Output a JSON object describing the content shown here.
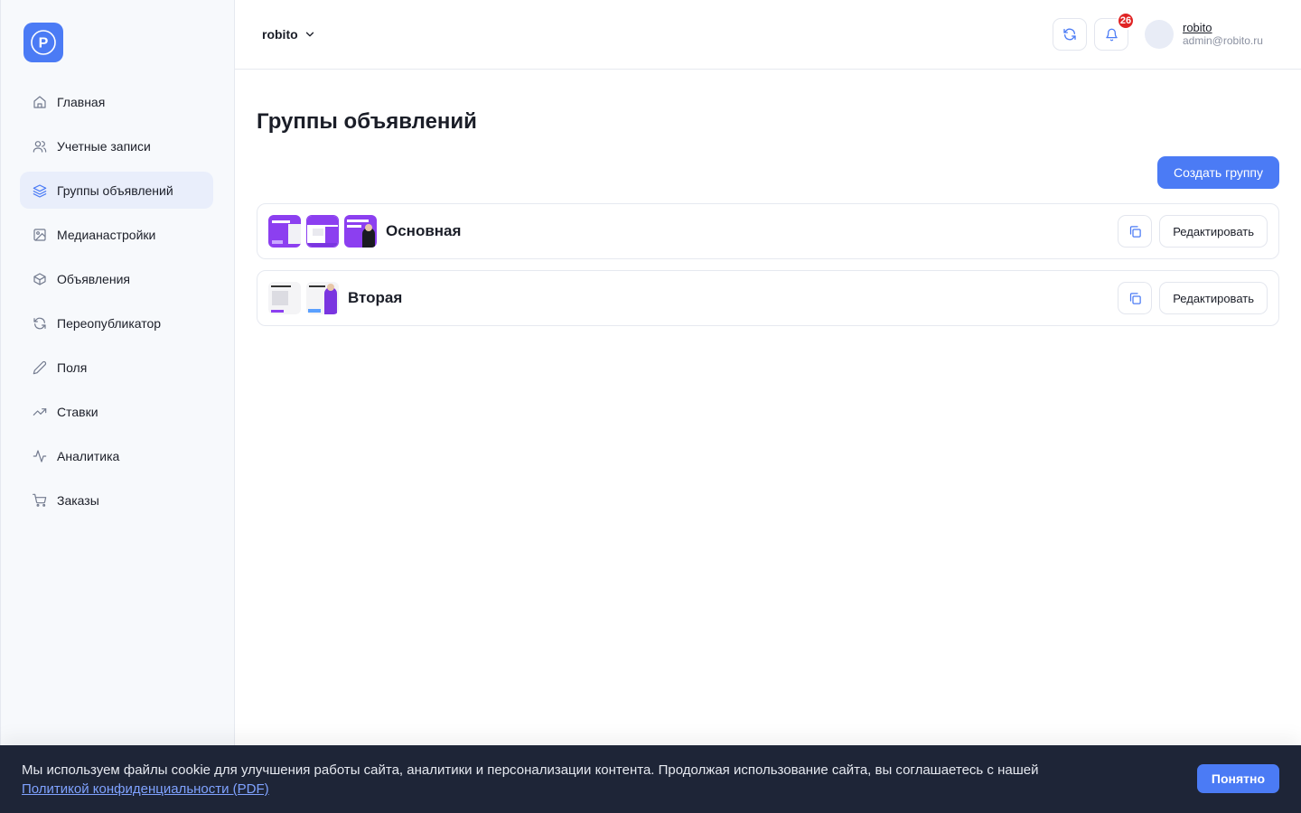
{
  "app": {
    "logo_letter": "P",
    "accent": "#4b7bf5"
  },
  "sidebar": {
    "items": [
      {
        "label": "Главная",
        "icon": "home-icon",
        "active": false
      },
      {
        "label": "Учетные записи",
        "icon": "users-icon",
        "active": false
      },
      {
        "label": "Группы объявлений",
        "icon": "layers-icon",
        "active": true
      },
      {
        "label": "Медианастройки",
        "icon": "image-icon",
        "active": false
      },
      {
        "label": "Объявления",
        "icon": "box-icon",
        "active": false
      },
      {
        "label": "Переопубликатор",
        "icon": "refresh-icon",
        "active": false
      },
      {
        "label": "Поля",
        "icon": "pencil-icon",
        "active": false
      },
      {
        "label": "Ставки",
        "icon": "trending-up-icon",
        "active": false
      },
      {
        "label": "Аналитика",
        "icon": "activity-icon",
        "active": false
      },
      {
        "label": "Заказы",
        "icon": "cart-icon",
        "active": false
      }
    ]
  },
  "header": {
    "workspace": "robito",
    "notifications_count": "26",
    "user": {
      "name": "robito",
      "email": "admin@robito.ru"
    }
  },
  "main": {
    "title": "Группы объявлений",
    "create_button": "Создать группу",
    "groups": [
      {
        "name": "Основная",
        "edit_label": "Редактировать"
      },
      {
        "name": "Вторая",
        "edit_label": "Редактировать"
      }
    ]
  },
  "cookie": {
    "text": "Мы используем файлы cookie для улучшения работы сайта, аналитики и персонализации контента. Продолжая использование сайта, вы соглашаетесь с нашей ",
    "link": "Политикой конфиденциальности (PDF)",
    "button": "Понятно"
  }
}
